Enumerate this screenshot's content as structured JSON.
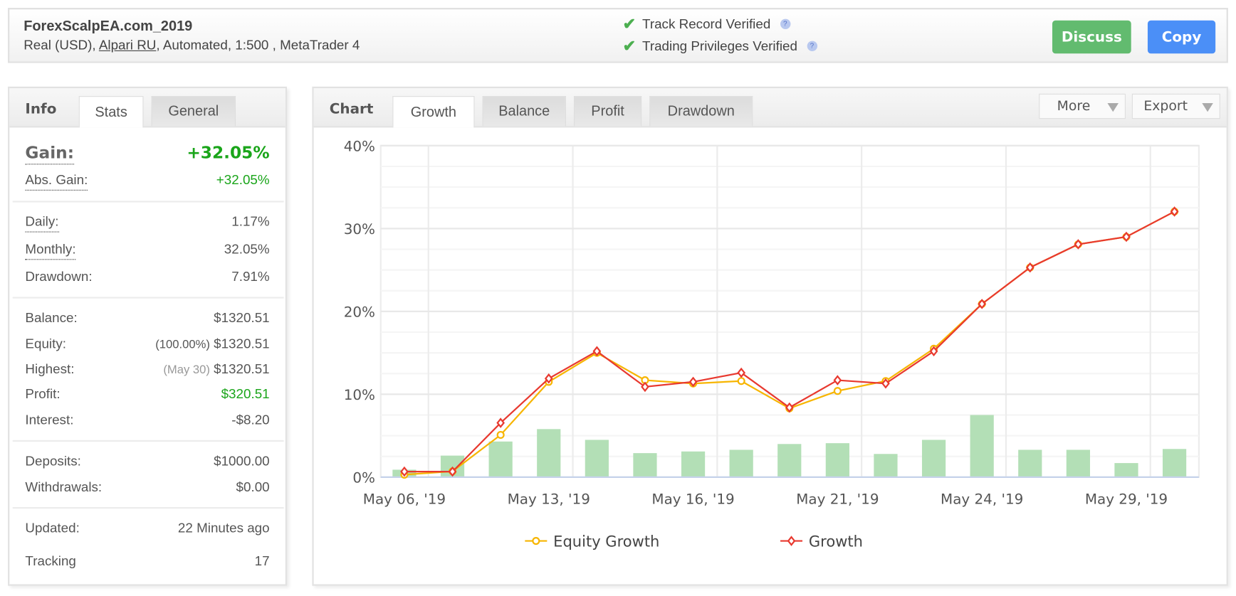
{
  "header": {
    "title": "ForexScalpEA.com_2019",
    "account_type": "Real (USD), ",
    "broker": "Alpari RU",
    "details": ", Automated, 1:500 , MetaTrader 4",
    "verifications": [
      "Track Record Verified",
      "Trading Privileges Verified"
    ],
    "discuss_label": "Discuss",
    "copy_label": "Copy",
    "colors": {
      "discuss": "#62bb6f",
      "copy": "#4b8ff7",
      "check": "#4caf50"
    }
  },
  "info_panel": {
    "title": "Info",
    "tabs": [
      {
        "label": "Stats",
        "active": true
      },
      {
        "label": "General",
        "active": false
      }
    ],
    "gain": {
      "label": "Gain:",
      "value": "+32.05%"
    },
    "abs_gain": {
      "label": "Abs. Gain:",
      "value": "+32.05%"
    },
    "daily": {
      "label": "Daily:",
      "value": "1.17%"
    },
    "monthly": {
      "label": "Monthly:",
      "value": "32.05%"
    },
    "drawdown": {
      "label": "Drawdown:",
      "value": "7.91%"
    },
    "balance": {
      "label": "Balance:",
      "value": "$1320.51"
    },
    "equity": {
      "label": "Equity:",
      "note": "(100.00%)",
      "value": "$1320.51"
    },
    "highest": {
      "label": "Highest:",
      "note": "(May 30)",
      "value": "$1320.51"
    },
    "profit": {
      "label": "Profit:",
      "value": "$320.51"
    },
    "interest": {
      "label": "Interest:",
      "value": "-$8.20"
    },
    "deposits": {
      "label": "Deposits:",
      "value": "$1000.00"
    },
    "withdrawals": {
      "label": "Withdrawals:",
      "value": "$0.00"
    },
    "updated": {
      "label": "Updated:",
      "value": "22 Minutes ago"
    },
    "tracking": {
      "label": "Tracking",
      "value": "17"
    }
  },
  "chart_panel": {
    "title": "Chart",
    "tabs": [
      {
        "label": "Growth",
        "active": true
      },
      {
        "label": "Balance",
        "active": false
      },
      {
        "label": "Profit",
        "active": false
      },
      {
        "label": "Drawdown",
        "active": false
      }
    ],
    "more_label": "More",
    "export_label": "Export"
  },
  "chart_data": {
    "type": "line",
    "ylim": [
      0,
      40
    ],
    "yticks": [
      "0%",
      "10%",
      "20%",
      "30%",
      "40%"
    ],
    "ytick_values": [
      0,
      10,
      20,
      30,
      40
    ],
    "x_tick_labels": [
      {
        "index": 0,
        "label": "May 06, '19"
      },
      {
        "index": 3,
        "label": "May 13, '19"
      },
      {
        "index": 6,
        "label": "May 16, '19"
      },
      {
        "index": 9,
        "label": "May 21, '19"
      },
      {
        "index": 12,
        "label": "May 24, '19"
      },
      {
        "index": 15,
        "label": "May 29, '19"
      }
    ],
    "grid": true,
    "legend_placement": "bottom",
    "series": [
      {
        "name": "Equity Growth",
        "type": "line",
        "color": "#f7b500",
        "marker": "circle",
        "values": [
          0.3,
          0.7,
          5.1,
          11.5,
          15.0,
          11.7,
          11.3,
          11.6,
          8.3,
          10.4,
          11.6,
          15.5,
          20.9,
          25.3,
          28.1,
          29.0,
          32.05
        ]
      },
      {
        "name": "Growth",
        "type": "line",
        "color": "#e8392f",
        "marker": "diamond",
        "values": [
          0.67,
          0.67,
          6.55,
          11.9,
          15.2,
          10.9,
          11.5,
          12.6,
          8.4,
          11.7,
          11.3,
          15.2,
          20.9,
          25.3,
          28.1,
          29.0,
          32.05
        ]
      },
      {
        "type": "bar",
        "color": "#b3dfb6",
        "values": [
          0.9,
          2.6,
          4.3,
          5.8,
          4.5,
          2.9,
          3.1,
          3.3,
          4.0,
          4.1,
          2.8,
          4.5,
          7.5,
          3.3,
          3.3,
          1.7,
          3.4
        ]
      }
    ]
  }
}
